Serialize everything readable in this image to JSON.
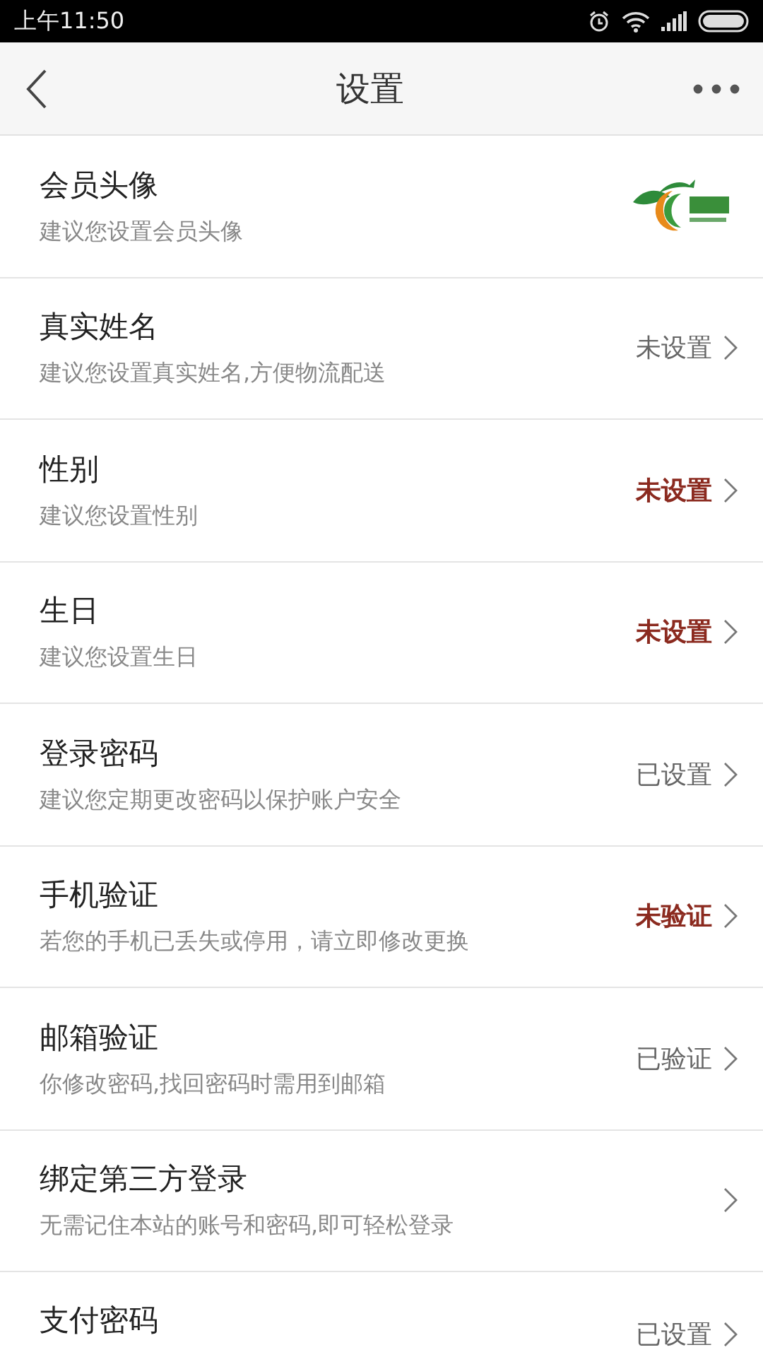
{
  "status_bar": {
    "time": "上午11:50"
  },
  "nav": {
    "title": "设置"
  },
  "rows": [
    {
      "kind": "avatar",
      "title": "会员头像",
      "subtitle": "建议您设置会员头像"
    },
    {
      "kind": "link",
      "title": "真实姓名",
      "subtitle": "建议您设置真实姓名,方便物流配送",
      "value": "未设置",
      "highlighted": false
    },
    {
      "kind": "link",
      "title": "性别",
      "subtitle": "建议您设置性别",
      "value": "未设置",
      "highlighted": true
    },
    {
      "kind": "link",
      "title": "生日",
      "subtitle": "建议您设置生日",
      "value": "未设置",
      "highlighted": true
    },
    {
      "kind": "link",
      "title": "登录密码",
      "subtitle": "建议您定期更改密码以保护账户安全",
      "value": "已设置",
      "highlighted": false
    },
    {
      "kind": "link",
      "title": "手机验证",
      "subtitle": "若您的手机已丢失或停用，请立即修改更换",
      "value": "未验证",
      "highlighted": true
    },
    {
      "kind": "link",
      "title": "邮箱验证",
      "subtitle": "你修改密码,找回密码时需用到邮箱",
      "value": "已验证",
      "highlighted": false
    },
    {
      "kind": "link",
      "title": "绑定第三方登录",
      "subtitle": "无需记住本站的账号和密码,即可轻松登录"
    },
    {
      "kind": "link",
      "title": "支付密码",
      "value": "已设置",
      "highlighted": false
    }
  ]
}
